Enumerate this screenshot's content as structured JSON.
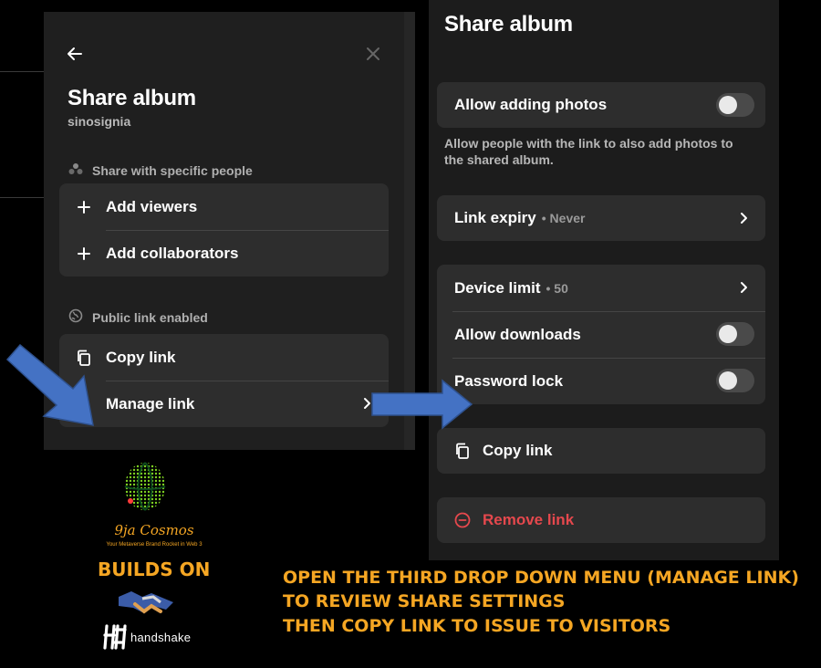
{
  "left_panel": {
    "title": "Share album",
    "owner": "sinosignia",
    "specific_section_label": "Share with specific people",
    "add_viewers_label": "Add viewers",
    "add_collaborators_label": "Add collaborators",
    "public_section_label": "Public link enabled",
    "copy_link_label": "Copy link",
    "manage_link_label": "Manage link"
  },
  "right_panel": {
    "title": "Share album",
    "allow_adding_photos_label": "Allow adding photos",
    "allow_adding_photos_on": false,
    "allow_adding_photos_desc": "Allow people with the link to also add photos to the shared album.",
    "link_expiry_label": "Link expiry",
    "link_expiry_value": "• Never",
    "device_limit_label": "Device limit",
    "device_limit_value": "• 50",
    "allow_downloads_label": "Allow downloads",
    "allow_downloads_on": false,
    "password_lock_label": "Password lock",
    "password_lock_on": false,
    "copy_link_label": "Copy link",
    "remove_link_label": "Remove link"
  },
  "branding": {
    "logo_name": "9ja Cosmos",
    "logo_tagline": "Your Metaverse Brand Rocket in Web 3",
    "builds_on": "BUILDS ON",
    "partner_name": "handshake"
  },
  "instructions": {
    "line1": "OPEN THE THIRD DROP DOWN MENU (MANAGE LINK)",
    "line2": "TO REVIEW SHARE SETTINGS",
    "line3": "THEN COPY LINK TO ISSUE TO VISITORS"
  },
  "colors": {
    "accent_yellow": "#f5a623",
    "arrow_blue": "#4472c4",
    "danger_red": "#e5484d",
    "logo_green": "#7ed321",
    "logo_orange": "#f5a623"
  },
  "icons": [
    "back-arrow-icon",
    "close-icon",
    "people-icon",
    "plus-icon",
    "globe-icon",
    "copy-icon",
    "chevron-right-icon",
    "remove-circle-icon",
    "handshake-icon"
  ]
}
